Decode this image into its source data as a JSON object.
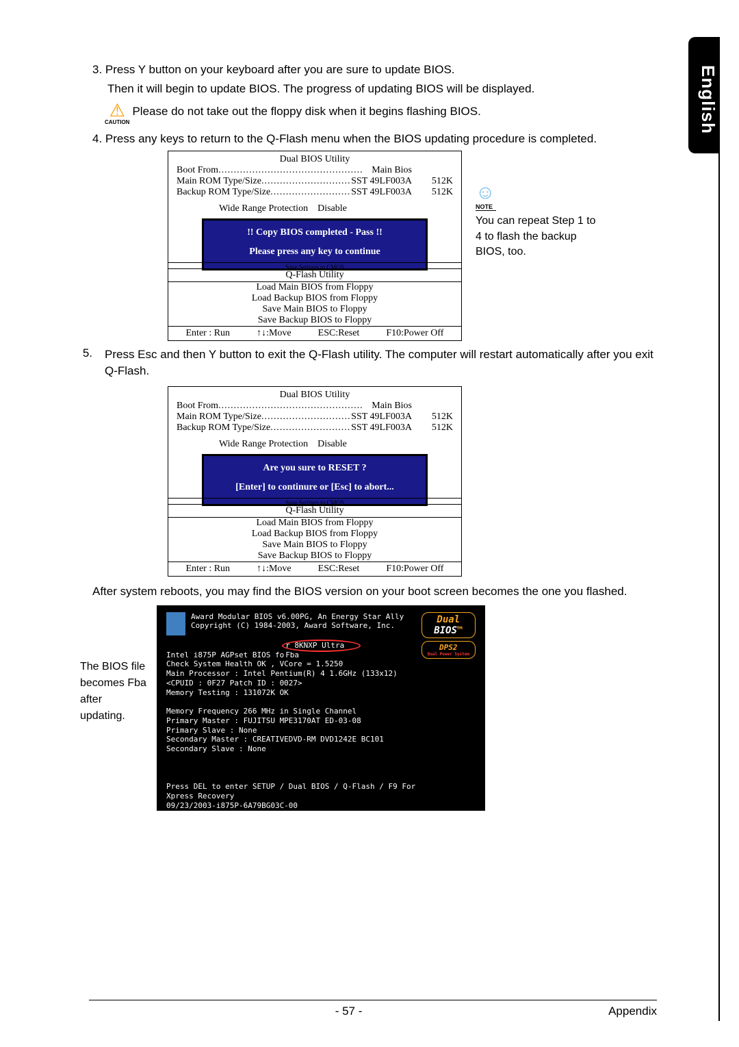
{
  "lang_tab": "English",
  "step3_line1": "3. Press Y button on your keyboard after you are sure to update BIOS.",
  "step3_line2": "Then it will begin to update BIOS. The progress of updating BIOS will be displayed.",
  "caution_label": "CAUTION",
  "caution_text": "Please do not take out the floppy disk when it begins flashing BIOS.",
  "step4": "4. Press any keys to return to the Q-Flash menu when the BIOS updating procedure is completed.",
  "bios_box": {
    "title": "Dual BIOS Utility",
    "boot_from": {
      "label": "Boot From",
      "value": "Main Bios"
    },
    "main_rom": {
      "label": "Main ROM Type/Size",
      "value": "SST 49LF003A",
      "size": "512K"
    },
    "backup_rom": {
      "label": "Backup ROM Type/Size",
      "value": "SST 49LF003A",
      "size": "512K"
    },
    "wrp": {
      "label": "Wide Range Protection",
      "value": "Disable"
    },
    "util_hdr": "Save Settings to CMOS",
    "util_title": "Q-Flash Utility",
    "util_items": [
      "Load Main BIOS from Floppy",
      "Load Backup BIOS from Floppy",
      "Save Main BIOS to Floppy",
      "Save Backup BIOS to Floppy"
    ],
    "keys": [
      "Enter : Run",
      "↑↓:Move",
      "ESC:Reset",
      "F10:Power Off"
    ]
  },
  "msg1": {
    "l1": "!! Copy BIOS completed - Pass !!",
    "l2": "Please press any key to continue"
  },
  "note": {
    "label": "NOTE",
    "text": "You can repeat Step 1 to 4 to flash the backup BIOS, too."
  },
  "step5": "Press Esc and then Y button to exit the Q-Flash utility. The computer will restart automatically after you exit Q-Flash.",
  "step5_num": "5.",
  "msg2": {
    "l1": "Are you sure to RESET ?",
    "l2": "[Enter] to continure or [Esc] to abort..."
  },
  "result_text": "After system reboots, you may find the BIOS version on your boot screen becomes the one you flashed.",
  "boot_label": "The BIOS file becomes Fba after updating.",
  "boot": {
    "award1": "Award Modular BIOS v6.00PG, An Energy Star Ally",
    "award2": "Copyright  (C) 1984-2003, Award Software,  Inc.",
    "logo_dual_a": "Dual",
    "logo_dual_b": "BIOS",
    "logo_dps": "DPS2",
    "logo_dps_sub": "Dual Power System",
    "l1a": "Intel i875P AGPset BIOS fo",
    "l1b": "r 8KNXP Ultra Fba",
    "l2": "Check System Health OK , VCore = 1.5250",
    "l3": "Main Processor : Intel Pentium(R) 4  1.6GHz (133x12)",
    "l4": "<CPUID : 0F27 Patch ID  : 0027>",
    "l5": "Memory Testing  : 131072K OK",
    "l6": "Memory Frequency 266 MHz in Single Channel",
    "l7": "Primary Master : FUJITSU MPE3170AT ED-03-08",
    "l8": "Primary Slave : None",
    "l9": "Secondary Master :  CREATIVEDVD-RM DVD1242E BC101",
    "l10": "Secondary Slave : None",
    "f1": "Press DEL to enter SETUP / Dual BIOS / Q-Flash / F9 For",
    "f2": "Xpress Recovery",
    "f3": "09/23/2003-i875P-6A79BG03C-00"
  },
  "footer": {
    "page": "- 57 -",
    "section": "Appendix"
  }
}
